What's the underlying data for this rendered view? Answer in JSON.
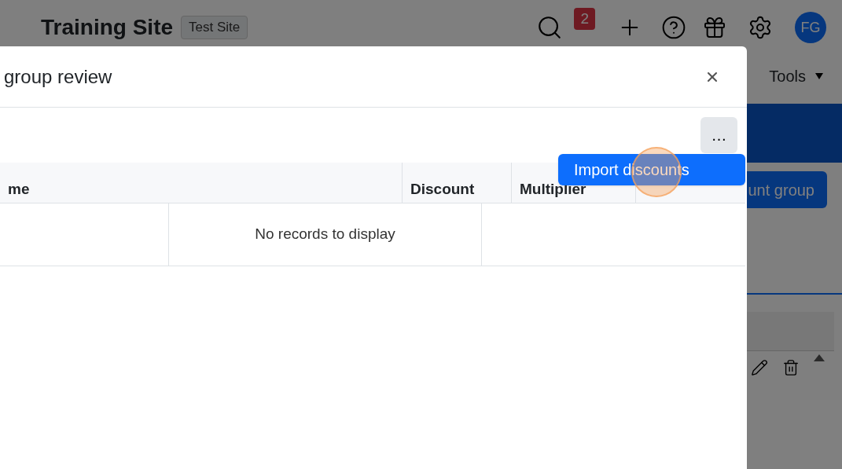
{
  "header": {
    "title": "Training Site",
    "badge": "Test Site",
    "notification_count": "2",
    "avatar": "FG"
  },
  "nav": {
    "items": [
      {
        "label": "Tools",
        "dropdown": true
      }
    ]
  },
  "page": {
    "button": "unt group"
  },
  "modal": {
    "title": "group review",
    "menu_button": "…",
    "table": {
      "columns": [
        "me",
        "Discount",
        "Multiplier"
      ],
      "empty_message": "No records to display"
    },
    "menu": {
      "items": [
        {
          "label": "Import discounts",
          "selected": true
        }
      ]
    }
  }
}
